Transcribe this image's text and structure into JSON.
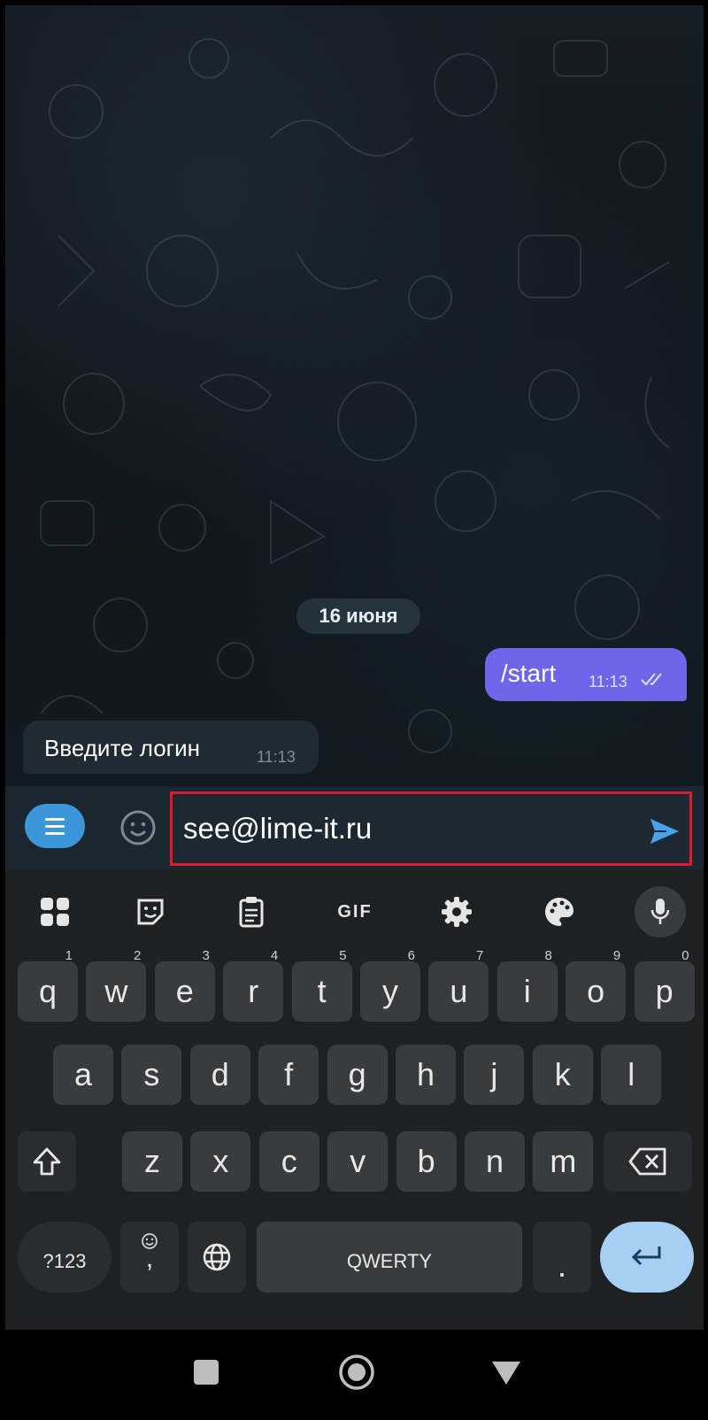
{
  "chat": {
    "date": "16 июня",
    "outgoing": {
      "text": "/start",
      "time": "11:13"
    },
    "incoming": {
      "text": "Введите логин",
      "time": "11:13"
    }
  },
  "input": {
    "value": "see@lime-it.ru"
  },
  "keyboard": {
    "toolbar": {
      "gif": "GIF"
    },
    "row1": [
      {
        "k": "q",
        "n": "1"
      },
      {
        "k": "w",
        "n": "2"
      },
      {
        "k": "e",
        "n": "3"
      },
      {
        "k": "r",
        "n": "4"
      },
      {
        "k": "t",
        "n": "5"
      },
      {
        "k": "y",
        "n": "6"
      },
      {
        "k": "u",
        "n": "7"
      },
      {
        "k": "i",
        "n": "8"
      },
      {
        "k": "o",
        "n": "9"
      },
      {
        "k": "p",
        "n": "0"
      }
    ],
    "row2": [
      "a",
      "s",
      "d",
      "f",
      "g",
      "h",
      "j",
      "k",
      "l"
    ],
    "row3": [
      "z",
      "x",
      "c",
      "v",
      "b",
      "n",
      "m"
    ],
    "symbols_label": "?123",
    "comma_label": ",",
    "space_label": "QWERTY",
    "period_label": "."
  },
  "colors": {
    "accent": "#3b95d9",
    "outgoing_bubble": "#6e66e8",
    "highlight_border": "#d91d2c"
  }
}
